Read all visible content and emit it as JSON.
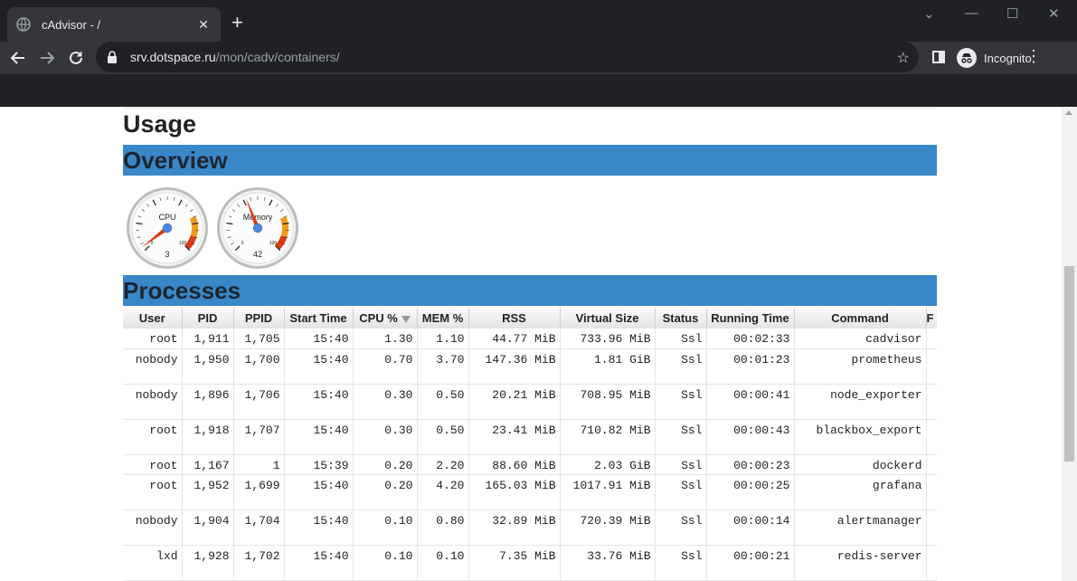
{
  "browser": {
    "tab_title": "cAdvisor - /",
    "tab_close": "✕",
    "new_tab": "+",
    "url_host": "srv.dotspace.ru",
    "url_path": "/mon/cadv/containers/",
    "profile_label": "Incognito",
    "window_controls": {
      "collapse": "⌄",
      "minimize": "—",
      "maximize": "☐",
      "close": "✕"
    }
  },
  "page": {
    "heading": "Usage",
    "overview_title": "Overview",
    "processes_title": "Processes"
  },
  "gauges": [
    {
      "label": "CPU",
      "value": "3",
      "min_tick": "0",
      "max_tick": "100"
    },
    {
      "label": "Memory",
      "value": "42",
      "min_tick": "0",
      "max_tick": "100"
    }
  ],
  "table": {
    "columns": [
      "User",
      "PID",
      "PPID",
      "Start Time",
      "CPU %",
      "MEM %",
      "RSS",
      "Virtual Size",
      "Status",
      "Running Time",
      "Command",
      "F"
    ],
    "rows": [
      {
        "user": "root",
        "pid": "1,911",
        "ppid": "1,705",
        "start": "15:40",
        "cpu": "1.30",
        "mem": "1.10",
        "rss": "44.77 MiB",
        "vsize": "733.96 MiB",
        "status": "Ssl",
        "running": "00:02:33",
        "command": "cadvisor"
      },
      {
        "user": "nobody",
        "pid": "1,950",
        "ppid": "1,700",
        "start": "15:40",
        "cpu": "0.70",
        "mem": "3.70",
        "rss": "147.36 MiB",
        "vsize": "1.81 GiB",
        "status": "Ssl",
        "running": "00:01:23",
        "command": "prometheus"
      },
      {
        "user": "nobody",
        "pid": "1,896",
        "ppid": "1,706",
        "start": "15:40",
        "cpu": "0.30",
        "mem": "0.50",
        "rss": "20.21 MiB",
        "vsize": "708.95 MiB",
        "status": "Ssl",
        "running": "00:00:41",
        "command": "node_exporter"
      },
      {
        "user": "root",
        "pid": "1,918",
        "ppid": "1,707",
        "start": "15:40",
        "cpu": "0.30",
        "mem": "0.50",
        "rss": "23.41 MiB",
        "vsize": "710.82 MiB",
        "status": "Ssl",
        "running": "00:00:43",
        "command": "blackbox_export"
      },
      {
        "user": "root",
        "pid": "1,167",
        "ppid": "1",
        "start": "15:39",
        "cpu": "0.20",
        "mem": "2.20",
        "rss": "88.60 MiB",
        "vsize": "2.03 GiB",
        "status": "Ssl",
        "running": "00:00:23",
        "command": "dockerd"
      },
      {
        "user": "root",
        "pid": "1,952",
        "ppid": "1,699",
        "start": "15:40",
        "cpu": "0.20",
        "mem": "4.20",
        "rss": "165.03 MiB",
        "vsize": "1017.91 MiB",
        "status": "Ssl",
        "running": "00:00:25",
        "command": "grafana"
      },
      {
        "user": "nobody",
        "pid": "1,904",
        "ppid": "1,704",
        "start": "15:40",
        "cpu": "0.10",
        "mem": "0.80",
        "rss": "32.89 MiB",
        "vsize": "720.39 MiB",
        "status": "Ssl",
        "running": "00:00:14",
        "command": "alertmanager"
      },
      {
        "user": "lxd",
        "pid": "1,928",
        "ppid": "1,702",
        "start": "15:40",
        "cpu": "0.10",
        "mem": "0.10",
        "rss": "7.35 MiB",
        "vsize": "33.76 MiB",
        "status": "Ssl",
        "running": "00:00:21",
        "command": "redis-server"
      }
    ]
  }
}
